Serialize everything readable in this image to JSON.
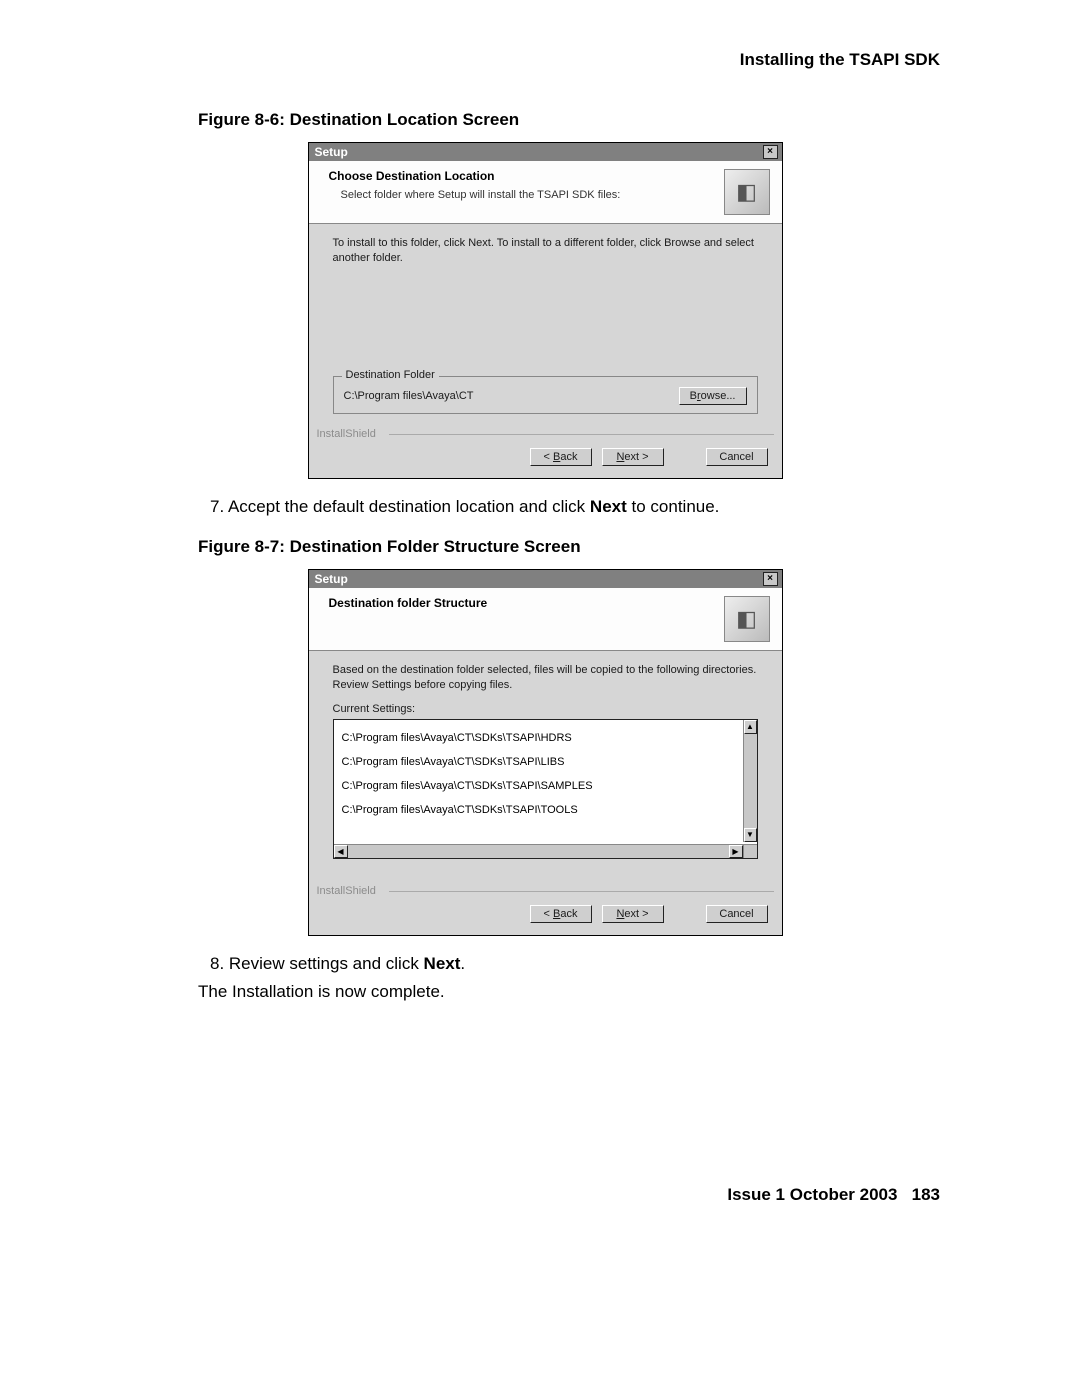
{
  "header": {
    "title": "Installing the TSAPI SDK"
  },
  "figure1": {
    "caption": "Figure 8-6: Destination Location Screen",
    "dialog": {
      "title": "Setup",
      "close_glyph": "×",
      "head_title": "Choose Destination Location",
      "head_sub": "Select folder where Setup will install the TSAPI SDK files:",
      "body_instr": "To install to this folder, click Next. To install to a different folder, click Browse and select another folder.",
      "group_legend": "Destination Folder",
      "dest_path": "C:\\Program files\\Avaya\\CT",
      "browse_label_pre": "B",
      "browse_label_mid": "r",
      "browse_label_post": "owse...",
      "brand": "InstallShield",
      "back_pre": "< ",
      "back_u": "B",
      "back_post": "ack",
      "next_u": "N",
      "next_post": "ext >",
      "cancel": "Cancel"
    }
  },
  "step7_pre": "7. Accept the default destination location and click ",
  "step7_bold": "Next",
  "step7_post": " to continue.",
  "figure2": {
    "caption": "Figure 8-7: Destination Folder Structure Screen",
    "dialog": {
      "title": "Setup",
      "close_glyph": "×",
      "head_title": "Destination folder Structure",
      "body_instr": "Based on the destination folder selected, files will be copied to the following directories. Review Settings before copying files.",
      "settings_label": "Current Settings:",
      "paths": {
        "p0": "C:\\Program files\\Avaya\\CT\\SDKs\\TSAPI\\HDRS",
        "p1": "C:\\Program files\\Avaya\\CT\\SDKs\\TSAPI\\LIBS",
        "p2": "C:\\Program files\\Avaya\\CT\\SDKs\\TSAPI\\SAMPLES",
        "p3": "C:\\Program files\\Avaya\\CT\\SDKs\\TSAPI\\TOOLS"
      },
      "brand": "InstallShield",
      "back_pre": "< ",
      "back_u": "B",
      "back_post": "ack",
      "next_u": "N",
      "next_post": "ext >",
      "cancel": "Cancel"
    }
  },
  "step8_pre": "8. Review settings and click ",
  "step8_bold": "Next",
  "step8_post": ".",
  "closing": "The Installation is now complete.",
  "footer": {
    "issue": "Issue 1   October 2003",
    "page": "183"
  }
}
